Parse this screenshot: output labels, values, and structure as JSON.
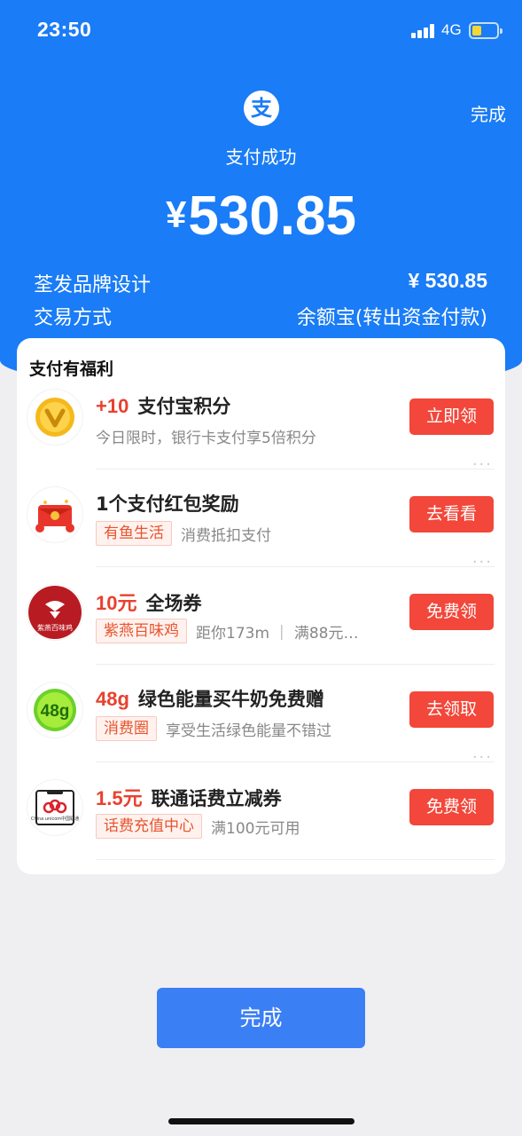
{
  "status_bar": {
    "time": "23:50",
    "network": "4G"
  },
  "header": {
    "logo_char": "支",
    "done_label": "完成",
    "status_text": "支付成功",
    "currency": "¥",
    "amount": "530.85"
  },
  "details": [
    {
      "label": "荃发品牌设计",
      "value": "¥ 530.85"
    },
    {
      "label": "交易方式",
      "value": "余额宝(转出资金付款)"
    }
  ],
  "benefits": {
    "title": "支付有福利",
    "items": [
      {
        "highlight": "+10",
        "title": "支付宝积分",
        "tag": "",
        "desc": "今日限时，银行卡支付享5倍积分",
        "button": "立即领",
        "icon": "points-coin-icon"
      },
      {
        "highlight": "",
        "title": "1个支付红包奖励",
        "tag": "有鱼生活",
        "desc": "消费抵扣支付",
        "button": "去看看",
        "icon": "red-envelope-icon"
      },
      {
        "highlight": "10元",
        "title": "全场券",
        "tag": "紫燕百味鸡",
        "desc": "距你173m ｜ 满88元…",
        "button": "免费领",
        "icon": "ziyan-logo-icon",
        "icon_text": "紫燕百味鸡"
      },
      {
        "highlight": "48g",
        "title": "绿色能量买牛奶免费赠",
        "tag": "消费圈",
        "desc": "享受生活绿色能量不错过",
        "button": "去领取",
        "icon": "green-energy-icon",
        "icon_text": "48g"
      },
      {
        "highlight": "1.5元",
        "title": "联通话费立减券",
        "tag": "话费充值中心",
        "desc": "满100元可用",
        "button": "免费领",
        "icon": "china-unicom-icon",
        "icon_text": "China unicom中国联通"
      }
    ]
  },
  "footer": {
    "done_label": "完成"
  },
  "colors": {
    "brand_blue": "#1a7cf6",
    "button_red": "#f2473a",
    "highlight_red": "#e8412f",
    "done_button": "#3b7ff5"
  }
}
